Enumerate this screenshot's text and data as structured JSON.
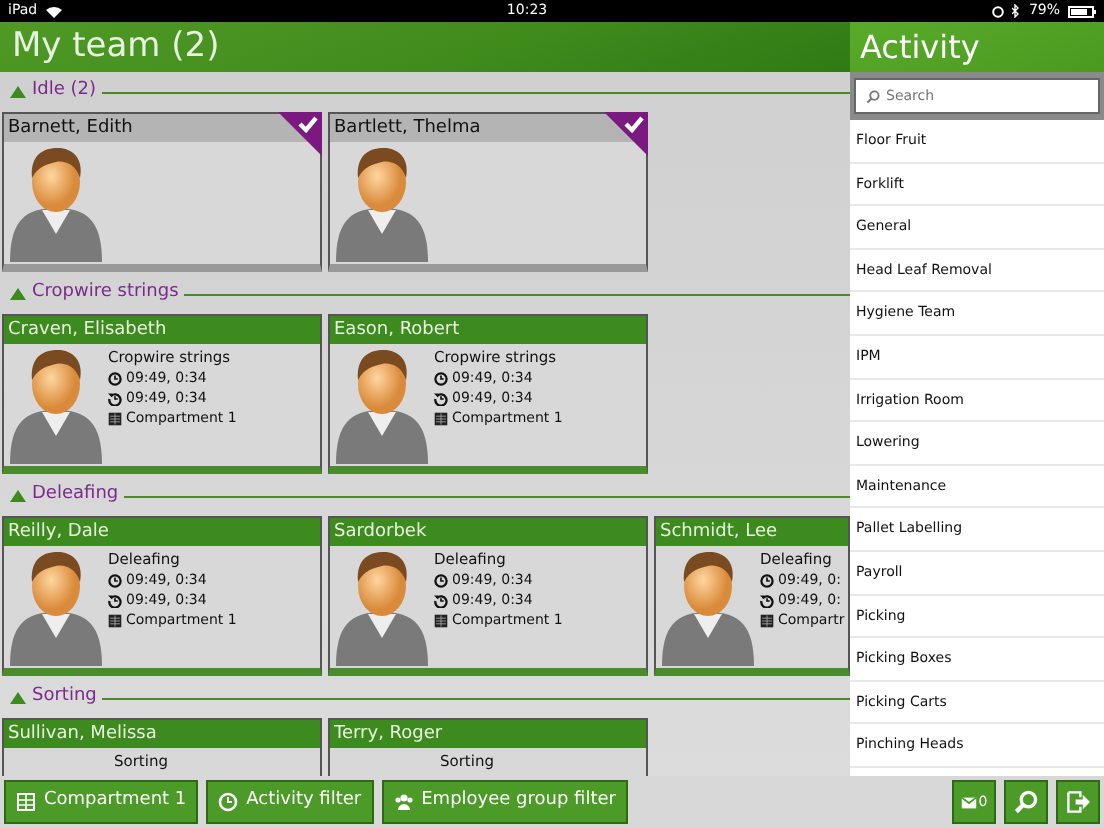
{
  "status_bar": {
    "device": "iPad",
    "time": "10:23",
    "battery": "79%"
  },
  "title": "My team (2)",
  "groups": [
    {
      "label": "Idle (2)",
      "expanded": true,
      "members": [
        {
          "name": "Barnett, Edith",
          "kind": "idle",
          "selected": true
        },
        {
          "name": "Bartlett, Thelma",
          "kind": "idle",
          "selected": true
        }
      ]
    },
    {
      "label": "Cropwire strings",
      "expanded": true,
      "members": [
        {
          "name": "Craven, Elisabeth",
          "kind": "working",
          "selected": false,
          "activity": "Cropwire strings",
          "started": "09:49, 0:34",
          "updated": "09:49, 0:34",
          "compartment": "Compartment 1"
        },
        {
          "name": "Eason, Robert",
          "kind": "working",
          "selected": false,
          "activity": "Cropwire strings",
          "started": "09:49, 0:34",
          "updated": "09:49, 0:34",
          "compartment": "Compartment 1"
        }
      ]
    },
    {
      "label": "Deleafing",
      "expanded": true,
      "members": [
        {
          "name": "Reilly, Dale",
          "kind": "working",
          "selected": false,
          "activity": "Deleafing",
          "started": "09:49, 0:34",
          "updated": "09:49, 0:34",
          "compartment": "Compartment 1"
        },
        {
          "name": "Sardorbek",
          "kind": "working",
          "selected": false,
          "activity": "Deleafing",
          "started": "09:49, 0:34",
          "updated": "09:49, 0:34",
          "compartment": "Compartment 1"
        },
        {
          "name": "Schmidt, Lee",
          "kind": "working",
          "selected": false,
          "activity": "Deleafing",
          "started": "09:49, 0:",
          "updated": "09:49, 0:",
          "compartment": "Compartr"
        }
      ]
    },
    {
      "label": "Sorting",
      "expanded": true,
      "members": [
        {
          "name": "Sullivan, Melissa",
          "kind": "working",
          "selected": false,
          "activity": "Sorting"
        },
        {
          "name": "Terry, Roger",
          "kind": "working",
          "selected": false,
          "activity": "Sorting"
        }
      ]
    }
  ],
  "activity_panel": {
    "title": "Activity",
    "search": {
      "placeholder": "Search"
    },
    "items": [
      "Floor Fruit",
      "Forklift",
      "General",
      "Head Leaf Removal",
      "Hygiene Team",
      "IPM",
      "Irrigation Room",
      "Lowering",
      "Maintenance",
      "Pallet Labelling",
      "Payroll",
      "Picking",
      "Picking Boxes",
      "Picking Carts",
      "Pinching Heads"
    ]
  },
  "toolbar": {
    "buttons": [
      {
        "kind": "compartment",
        "label": "Compartment 1"
      },
      {
        "kind": "activity",
        "label": "Activity filter"
      },
      {
        "kind": "employee-group",
        "label": "Employee group filter"
      }
    ],
    "actions": [
      {
        "kind": "mail",
        "label": "0"
      },
      {
        "kind": "search"
      },
      {
        "kind": "logout"
      }
    ]
  }
}
